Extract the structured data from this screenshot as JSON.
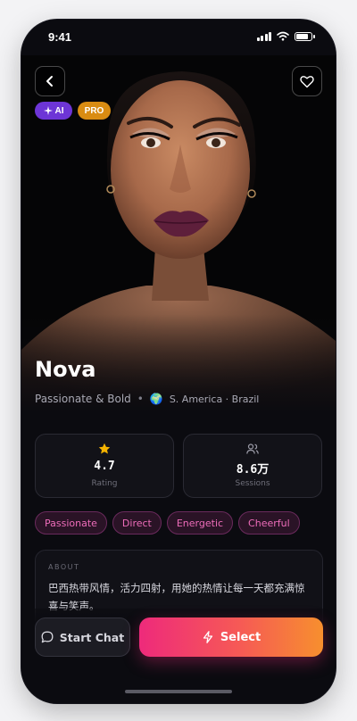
{
  "status_bar": {
    "time": "9:41"
  },
  "header": {
    "back_icon": "chevron-left-icon",
    "favorite_icon": "heart-icon"
  },
  "badges": [
    {
      "label": "AI",
      "icon": "sparkle-icon",
      "color": "#6d35d6"
    },
    {
      "label": "PRO",
      "color": "#d98c12"
    }
  ],
  "profile": {
    "name": "Nova",
    "personality": "Passionate & Bold",
    "separator": "•",
    "globe_emoji": "🌍",
    "location": "S. America · Brazil"
  },
  "stats": [
    {
      "icon": "star-icon",
      "value": "4.7",
      "label": "Rating"
    },
    {
      "icon": "users-icon",
      "value": "8.6万",
      "label": "Sessions"
    }
  ],
  "tags": [
    "Passionate",
    "Direct",
    "Energetic",
    "Cheerful"
  ],
  "about": {
    "title": "ABOUT",
    "text": "巴西热带风情，活力四射，用她的热情让每一天都充满惊喜与笑声。"
  },
  "actions": {
    "chat_label": "Start Chat",
    "select_label": "Select"
  },
  "colors": {
    "background": "#0b0b10",
    "accent_gradient_start": "#ee2a7b",
    "accent_gradient_end": "#f78f2e",
    "tag_text": "#ee6dba",
    "rating_star": "#f5b300"
  }
}
